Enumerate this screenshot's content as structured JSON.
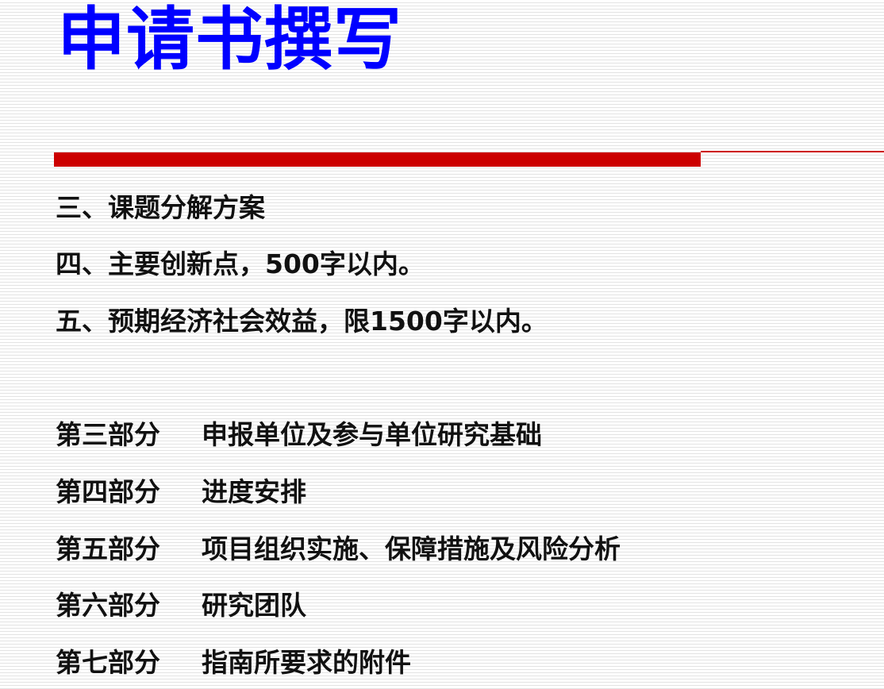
{
  "title": "申请书撰写",
  "sections": [
    "三、课题分解方案",
    "四、主要创新点，500字以内。",
    "五、预期经济社会效益，限1500字以内。"
  ],
  "parts": [
    {
      "label": "第三部分",
      "text": "申报单位及参与单位研究基础"
    },
    {
      "label": "第四部分",
      "text": "进度安排"
    },
    {
      "label": "第五部分",
      "text": "项目组织实施、保障措施及风险分析"
    },
    {
      "label": "第六部分",
      "text": "研究团队"
    },
    {
      "label": "第七部分",
      "text": "指南所要求的附件"
    }
  ],
  "colors": {
    "title": "#0000ff",
    "rule": "#cc0000",
    "text": "#111111"
  }
}
